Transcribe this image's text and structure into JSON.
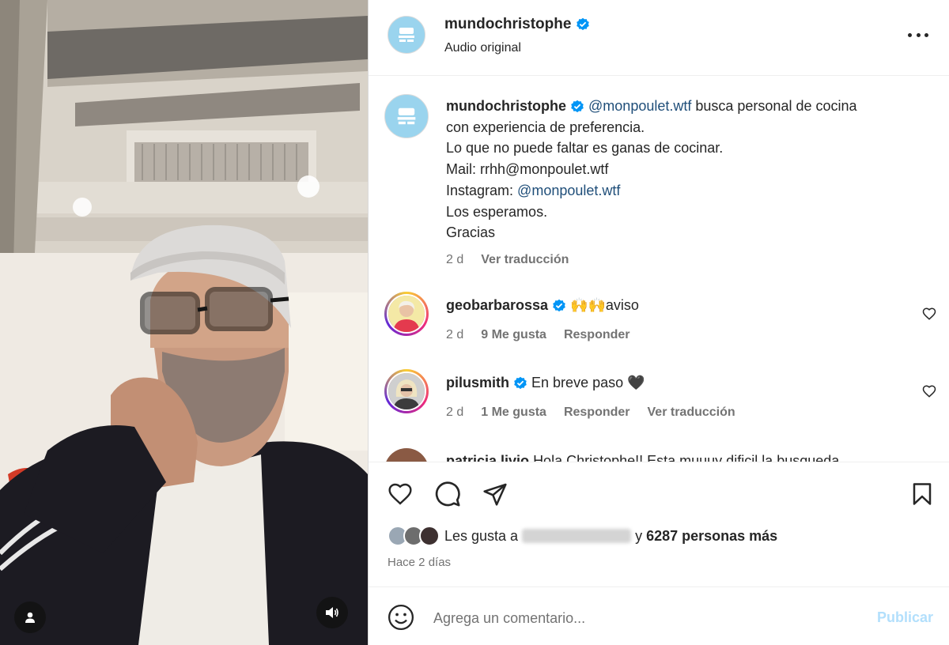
{
  "post": {
    "username": "mundochristophe",
    "audio": "Audio original"
  },
  "caption": {
    "author": "mundochristophe",
    "mention": "@monpoulet.wtf",
    "line1_rest": " busca personal de cocina",
    "line2": "con experiencia de preferencia.",
    "line3": "Lo que no puede faltar es ganas de cocinar.",
    "line4": "Mail: rrhh@monpoulet.wtf",
    "line5_prefix": "Instagram: ",
    "line5_mention": "@monpoulet.wtf",
    "line6": "Los esperamos.",
    "line7": "Gracias",
    "time": "2 d",
    "translate": "Ver traducción"
  },
  "comments": [
    {
      "author": "geobarbarossa",
      "text": "🙌🙌aviso",
      "time": "2 d",
      "likes": "9 Me gusta",
      "reply": "Responder"
    },
    {
      "author": "pilusmith",
      "text": "En breve paso 🖤",
      "time": "2 d",
      "likes": "1 Me gusta",
      "reply": "Responder",
      "translate": "Ver traducción"
    },
    {
      "author": "patricia.livio",
      "text": "Hola Christophe!! Esta muuuy dificil la busqueda"
    }
  ],
  "likes": {
    "prefix": "Les gusta a",
    "conj": "y",
    "count": "6287 personas más"
  },
  "posted_ago": "Hace 2 días",
  "comment_box": {
    "placeholder": "Agrega un comentario...",
    "publish": "Publicar"
  },
  "colors": {
    "verified": "#0095f6",
    "mention": "#1f4e79",
    "publish_disabled": "#b2dffc",
    "logo_bg": "#9ad4ee"
  },
  "icons": [
    "user-icon",
    "sound-icon",
    "more-icon",
    "verified-icon",
    "heart-icon",
    "comment-icon",
    "share-icon",
    "bookmark-icon",
    "emoji-icon"
  ]
}
